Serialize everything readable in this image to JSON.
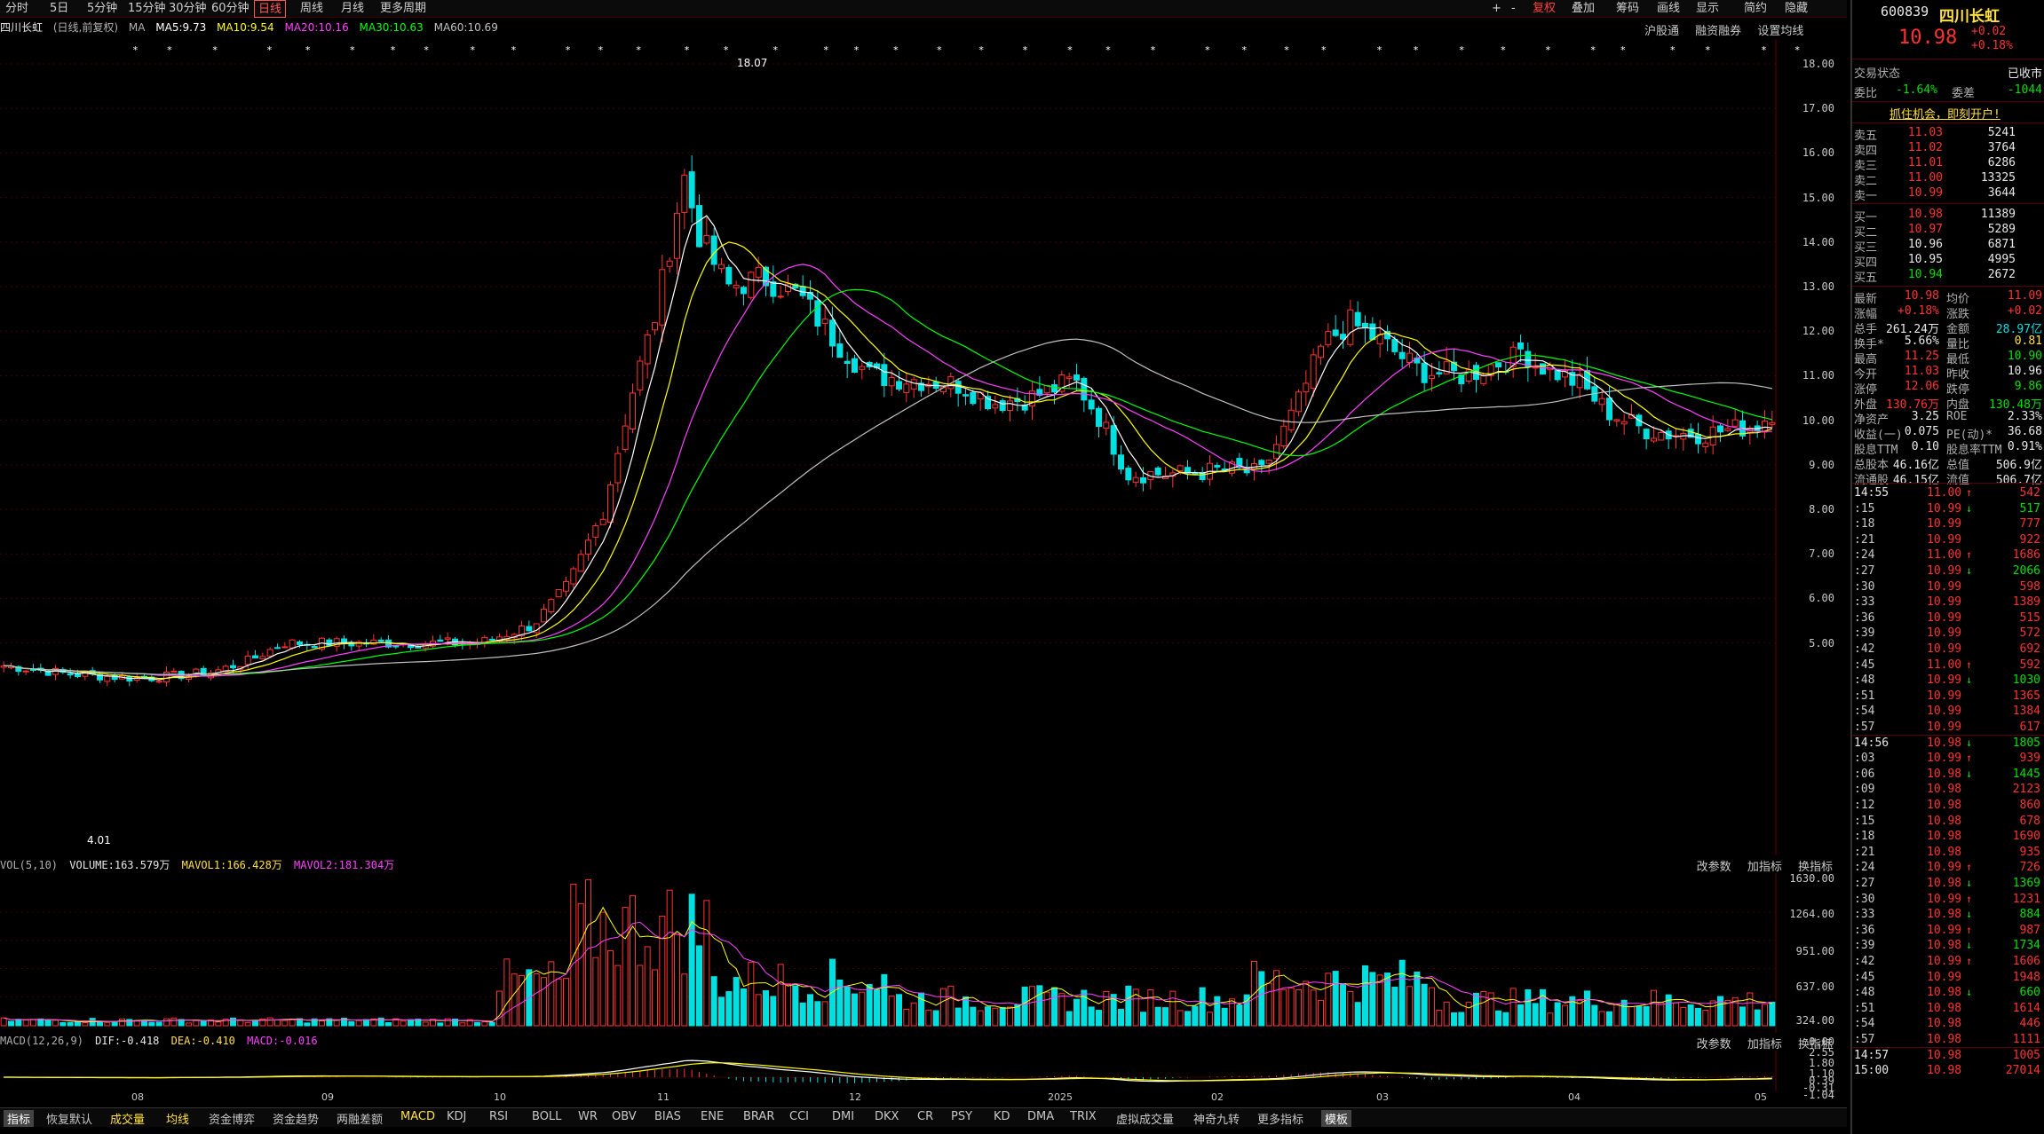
{
  "topbar": {
    "periods": [
      "分时",
      "5日",
      "5分钟",
      "15分钟",
      "30分钟",
      "60分钟",
      "日线",
      "周线",
      "月线",
      "更多周期"
    ],
    "active_period": "日线",
    "tools": [
      "+",
      "-",
      "复权",
      "叠加",
      "筹码",
      "画线",
      "显示",
      "简约",
      "隐藏"
    ]
  },
  "info": {
    "name": "四川长虹",
    "mode": "(日线,前复权)",
    "ma": "MA",
    "ma5": "MA5:9.73",
    "ma10": "MA10:9.54",
    "ma20": "MA20:10.16",
    "ma30": "MA30:10.63",
    "ma60": "MA60:10.69",
    "links": [
      "沪股通",
      "融资融券",
      "设置均线"
    ]
  },
  "price_axis": [
    "18.00",
    "17.00",
    "16.00",
    "15.00",
    "14.00",
    "13.00",
    "12.00",
    "11.00",
    "10.00",
    "9.00",
    "8.00",
    "7.00",
    "6.00",
    "5.00"
  ],
  "annotations": {
    "high": "18.07",
    "low": "4.01"
  },
  "volume_panel": {
    "header": [
      "VOL(5,10)",
      "VOLUME:163.579万",
      "MAVOL1:166.428万",
      "MAVOL2:181.304万"
    ],
    "axis": [
      "1630.00",
      "1264.00",
      "951.00",
      "637.00",
      "324.00",
      "0.00"
    ],
    "tools": [
      "改参数",
      "加指标",
      "换指标"
    ]
  },
  "macd_panel": {
    "header": [
      "MACD(12,26,9)",
      "DIF:-0.418",
      "DEA:-0.410",
      "MACD:-0.016"
    ],
    "axis": [
      "2.55",
      "1.80",
      "1.10",
      "0.39",
      "-0.31",
      "-1.04"
    ],
    "tools": [
      "改参数",
      "加指标",
      "换指标"
    ]
  },
  "x_axis": [
    "08",
    "09",
    "10",
    "11",
    "12",
    "2025",
    "02",
    "03",
    "04",
    "05"
  ],
  "bottom_tabs": [
    "指标",
    "恢复默认",
    "成交量",
    "均线",
    "资金博弈",
    "资金趋势",
    "两融差额",
    "MACD",
    "KDJ",
    "RSI",
    "BOLL",
    "WR",
    "OBV",
    "BIAS",
    "ENE",
    "BRAR",
    "CCI",
    "DMI",
    "DKX",
    "CR",
    "PSY",
    "KD",
    "DMA",
    "TRIX",
    "虚拟成交量",
    "神奇九转",
    "更多指标",
    "模板"
  ],
  "quote": {
    "code": "600839",
    "name": "四川长虹",
    "price": "10.98",
    "change": "+0.02",
    "change_pct": "+0.18%",
    "status_label": "交易状态",
    "status": "已收市",
    "weibi_label": "委比",
    "weibi": "-1.64%",
    "weicha_label": "委差",
    "weicha": "-1044",
    "promo": "抓住机会，即刻开户!",
    "asks": [
      {
        "label": "卖五",
        "price": "11.03",
        "vol": "5241"
      },
      {
        "label": "卖四",
        "price": "11.02",
        "vol": "3764"
      },
      {
        "label": "卖三",
        "price": "11.01",
        "vol": "6286"
      },
      {
        "label": "卖二",
        "price": "11.00",
        "vol": "13325"
      },
      {
        "label": "卖一",
        "price": "10.99",
        "vol": "3644"
      }
    ],
    "bids": [
      {
        "label": "买一",
        "price": "10.98",
        "vol": "11389"
      },
      {
        "label": "买二",
        "price": "10.97",
        "vol": "5289"
      },
      {
        "label": "买三",
        "price": "10.96",
        "vol": "6871"
      },
      {
        "label": "买四",
        "price": "10.95",
        "vol": "4995"
      },
      {
        "label": "买五",
        "price": "10.94",
        "vol": "2672"
      }
    ],
    "stats": [
      {
        "k1": "最新",
        "v1": "10.98",
        "c1": "red",
        "k2": "均价",
        "v2": "11.09",
        "c2": "red"
      },
      {
        "k1": "涨幅",
        "v1": "+0.18%",
        "c1": "red",
        "k2": "涨跌",
        "v2": "+0.02",
        "c2": "red"
      },
      {
        "k1": "总手",
        "v1": "261.24万",
        "c1": "white",
        "k2": "金额",
        "v2": "28.97亿",
        "c2": "cyan"
      },
      {
        "k1": "换手*",
        "v1": "5.66%",
        "c1": "white",
        "k2": "量比",
        "v2": "0.81",
        "c2": "yellow"
      },
      {
        "k1": "最高",
        "v1": "11.25",
        "c1": "red",
        "k2": "最低",
        "v2": "10.90",
        "c2": "green"
      },
      {
        "k1": "今开",
        "v1": "11.03",
        "c1": "red",
        "k2": "昨收",
        "v2": "10.96",
        "c2": "white"
      },
      {
        "k1": "涨停",
        "v1": "12.06",
        "c1": "red",
        "k2": "跌停",
        "v2": "9.86",
        "c2": "green"
      },
      {
        "k1": "外盘",
        "v1": "130.76万",
        "c1": "red",
        "k2": "内盘",
        "v2": "130.48万",
        "c2": "green"
      },
      {
        "k1": "净资产",
        "v1": "3.25",
        "c1": "white",
        "k2": "ROE",
        "v2": "2.33%",
        "c2": "white"
      },
      {
        "k1": "收益(一)",
        "v1": "0.075",
        "c1": "white",
        "k2": "PE(动)*",
        "v2": "36.68",
        "c2": "white"
      },
      {
        "k1": "股息TTM",
        "v1": "0.10",
        "c1": "white",
        "k2": "股息率TTM",
        "v2": "0.91%",
        "c2": "white"
      },
      {
        "k1": "总股本",
        "v1": "46.16亿",
        "c1": "white",
        "k2": "总值",
        "v2": "506.9亿",
        "c2": "white"
      },
      {
        "k1": "流通股",
        "v1": "46.15亿",
        "c1": "white",
        "k2": "流值",
        "v2": "506.7亿",
        "c2": "white"
      }
    ],
    "trades": [
      {
        "t": "14:55",
        "p": "11.00",
        "a": "up",
        "v": "542"
      },
      {
        "t": ":15",
        "p": "10.99",
        "a": "down",
        "v": "517"
      },
      {
        "t": ":18",
        "p": "10.99",
        "a": "",
        "v": "777"
      },
      {
        "t": ":21",
        "p": "10.99",
        "a": "",
        "v": "922"
      },
      {
        "t": ":24",
        "p": "11.00",
        "a": "up",
        "v": "1686"
      },
      {
        "t": ":27",
        "p": "10.99",
        "a": "down",
        "v": "2066"
      },
      {
        "t": ":30",
        "p": "10.99",
        "a": "",
        "v": "598"
      },
      {
        "t": ":33",
        "p": "10.99",
        "a": "",
        "v": "1389"
      },
      {
        "t": ":36",
        "p": "10.99",
        "a": "",
        "v": "515"
      },
      {
        "t": ":39",
        "p": "10.99",
        "a": "",
        "v": "572"
      },
      {
        "t": ":42",
        "p": "10.99",
        "a": "",
        "v": "692"
      },
      {
        "t": ":45",
        "p": "11.00",
        "a": "up",
        "v": "592"
      },
      {
        "t": ":48",
        "p": "10.99",
        "a": "down",
        "v": "1030"
      },
      {
        "t": ":51",
        "p": "10.99",
        "a": "",
        "v": "1365"
      },
      {
        "t": ":54",
        "p": "10.99",
        "a": "",
        "v": "1384"
      },
      {
        "t": ":57",
        "p": "10.99",
        "a": "",
        "v": "617"
      },
      {
        "t": "14:56",
        "p": "10.98",
        "a": "down",
        "v": "1805"
      },
      {
        "t": ":03",
        "p": "10.99",
        "a": "up",
        "v": "939"
      },
      {
        "t": ":06",
        "p": "10.98",
        "a": "down",
        "v": "1445"
      },
      {
        "t": ":09",
        "p": "10.98",
        "a": "",
        "v": "2123"
      },
      {
        "t": ":12",
        "p": "10.98",
        "a": "",
        "v": "860"
      },
      {
        "t": ":15",
        "p": "10.98",
        "a": "",
        "v": "678"
      },
      {
        "t": ":18",
        "p": "10.98",
        "a": "",
        "v": "1690"
      },
      {
        "t": ":21",
        "p": "10.98",
        "a": "",
        "v": "935"
      },
      {
        "t": ":24",
        "p": "10.99",
        "a": "up",
        "v": "726"
      },
      {
        "t": ":27",
        "p": "10.98",
        "a": "down",
        "v": "1369"
      },
      {
        "t": ":30",
        "p": "10.99",
        "a": "up",
        "v": "1231"
      },
      {
        "t": ":33",
        "p": "10.98",
        "a": "down",
        "v": "884"
      },
      {
        "t": ":36",
        "p": "10.99",
        "a": "up",
        "v": "987"
      },
      {
        "t": ":39",
        "p": "10.98",
        "a": "down",
        "v": "1734"
      },
      {
        "t": ":42",
        "p": "10.99",
        "a": "up",
        "v": "1606"
      },
      {
        "t": ":45",
        "p": "10.99",
        "a": "",
        "v": "1948"
      },
      {
        "t": ":48",
        "p": "10.98",
        "a": "down",
        "v": "660"
      },
      {
        "t": ":51",
        "p": "10.98",
        "a": "",
        "v": "1614"
      },
      {
        "t": ":54",
        "p": "10.98",
        "a": "",
        "v": "446"
      },
      {
        "t": ":57",
        "p": "10.98",
        "a": "",
        "v": "1111"
      },
      {
        "t": "14:57",
        "p": "10.98",
        "a": "",
        "v": "1005"
      },
      {
        "t": "15:00",
        "p": "10.98",
        "a": "",
        "v": "27014"
      }
    ]
  },
  "colors": {
    "up": "#ff3232",
    "down": "#00e0e0",
    "ma5": "#ffffff",
    "ma10": "#ffff00",
    "ma20": "#ff40ff",
    "ma30": "#00ff00",
    "ma60": "#c0c0c0"
  }
}
